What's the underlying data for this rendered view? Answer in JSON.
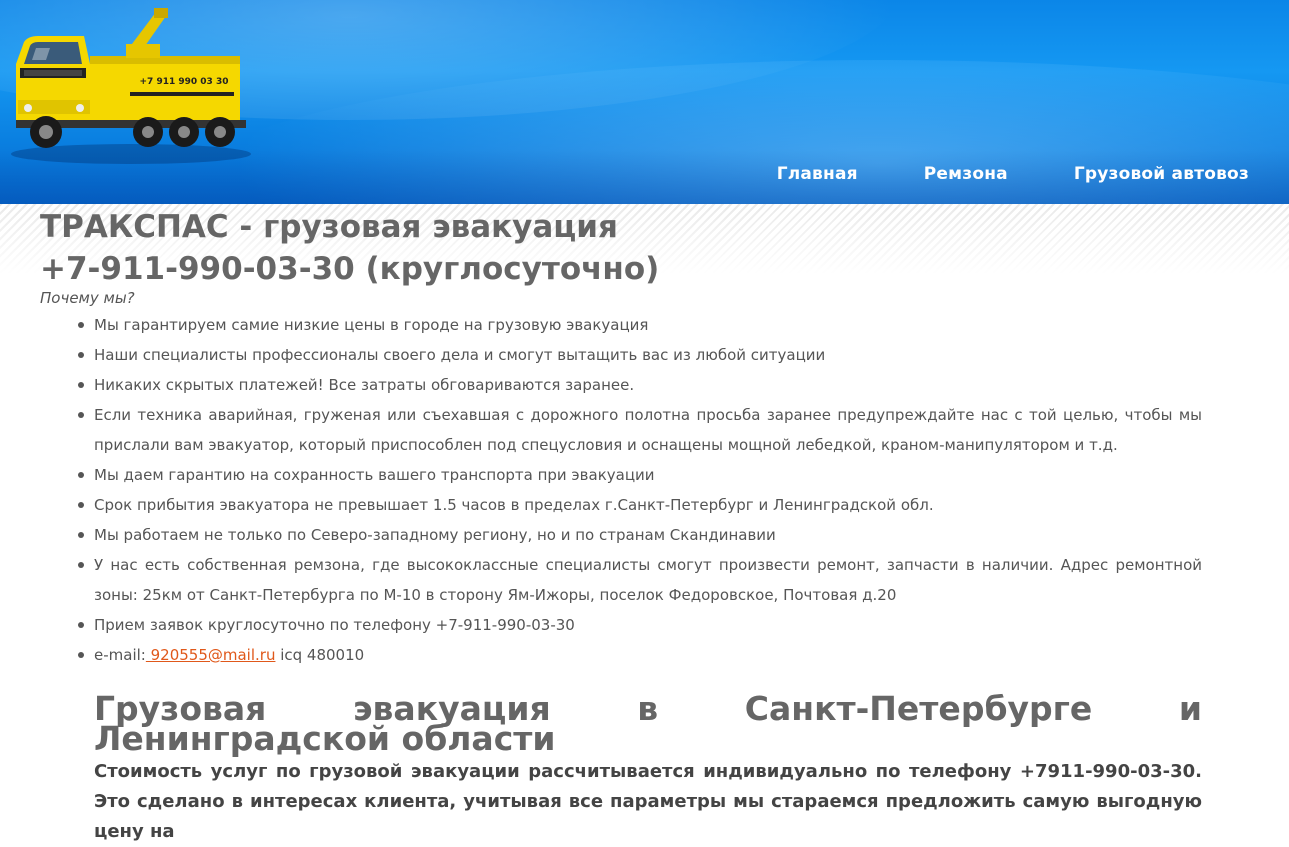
{
  "header": {
    "nav": [
      "Главная",
      "Ремзона",
      "Грузовой автовоз"
    ],
    "truck_text": "+7 911 990 03 30"
  },
  "main": {
    "title_line1": "ТРАКСПАС - грузовая эвакуация",
    "title_line2": "+7-911-990-03-30 (круглосуточно)",
    "why_label": "Почему мы?",
    "benefits": [
      "Мы гарантируем самие низкие цены в городе на грузовую эвакуация",
      "Наши специалисты профессионалы своего дела и смогут вытащить вас из любой ситуации",
      "Никаких скрытых платежей! Все затраты обговариваются заранее.",
      "Если техника аварийная, груженая или съехавшая с дорожного полотна просьба заранее предупреждайте нас с той целью, чтобы мы прислали вам эвакуатор, который приспособлен под спецусловия и оснащены мощной лебедкой, краном-манипулятором и т.д.",
      "Мы даем гарантию на сохранность вашего транспорта при эвакуации",
      "Срок прибытия эвакуатора не превышает 1.5 часов в пределах г.Санкт-Петербург и Ленинградской обл.",
      "Мы работаем не только по Северо-западному региону, но и по странам Скандинавии",
      "У нас есть собственная ремзона, где высококлассные специалисты смогут произвести ремонт, запчасти в наличии. Адрес ремонтной зоны: 25км от Санкт-Петербурга по М-10 в сторону Ям-Ижоры, поселок Федоровское, Почтовая д.20",
      "Прием заявок круглосуточно по телефону +7-911-990-03-30"
    ],
    "email_label": "e-mail:",
    "email": " 920555@mail.ru",
    "icq": " icq 480010",
    "section_title": "Грузовая эвакуация в Санкт-Петербурге и Ленинградской области",
    "intro": "Стоимость услуг по грузовой эвакуации рассчитывается индивидуально по телефону +7911-990-03-30. Это сделано в интересах клиента, учитывая все параметры мы стараемся предложить самую выгодную цену на"
  },
  "colors": {
    "header_blue": "#0b86e8",
    "link_orange": "#e0581a",
    "text_gray": "#555555",
    "truck_yellow": "#f5d800"
  }
}
